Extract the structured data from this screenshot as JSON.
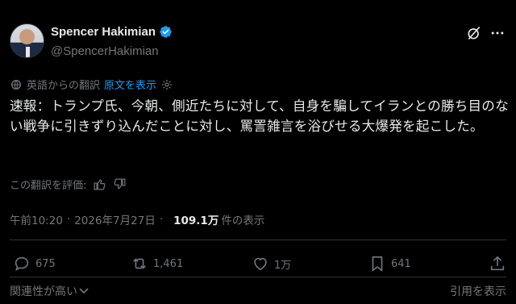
{
  "author": {
    "display_name": "Spencer Hakimian",
    "handle": "@SpencerHakimian"
  },
  "translation": {
    "label": "英語からの翻訳",
    "show_original": "原文を表示"
  },
  "tweet": {
    "text": "速報：トランプ氏、今朝、側近たちに対して、自身を騙してイランとの勝ち目のない戦争に引きずり込んだことに対し、罵詈雑言を浴びせる大爆発を起こした。"
  },
  "rating": {
    "label": "この翻訳を評価:"
  },
  "meta": {
    "time": "午前10:20",
    "separator": "·",
    "date": "2026年7月27日",
    "views_count": "109.1万",
    "views_label": "件の表示"
  },
  "actions": {
    "replies": "675",
    "reposts": "1,461",
    "likes": "1万",
    "bookmarks": "641"
  },
  "footer": {
    "relevance": "関連性が高い",
    "quotes": "引用を表示"
  },
  "colors": {
    "background": "#000000",
    "text": "#e7e9ea",
    "muted": "#71767b",
    "accent": "#1d9bf0"
  }
}
